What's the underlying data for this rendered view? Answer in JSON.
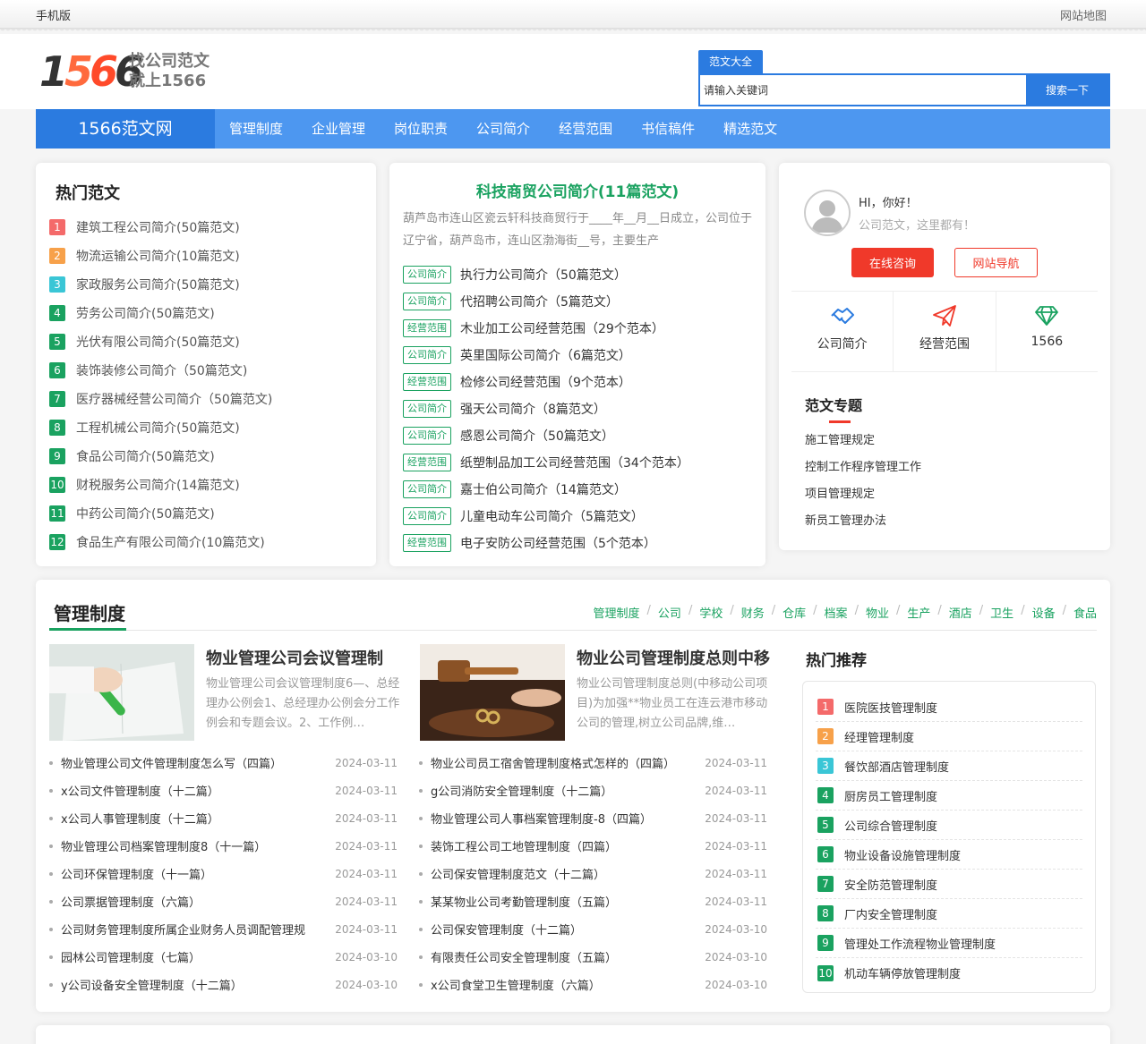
{
  "colors": {
    "primary": "#2b7be0",
    "nav": "#4d97f0",
    "green": "#1aa260",
    "red": "#f0392a",
    "rank": [
      "#f46a6a",
      "#f7a14a",
      "#3ac6d6",
      "#1aa260"
    ]
  },
  "topbar": {
    "mobile": "手机版",
    "sitemap": "网站地图"
  },
  "logo": {
    "digits": [
      "1",
      "5",
      "6",
      "6"
    ],
    "slogan_line1": "找公司范文",
    "slogan_line2": "就上1566"
  },
  "search": {
    "tab": "范文大全",
    "placeholder": "请输入关键词",
    "button": "搜索一下"
  },
  "nav": {
    "brand": "1566范文网",
    "items": [
      "管理制度",
      "企业管理",
      "岗位职责",
      "公司简介",
      "经营范围",
      "书信稿件",
      "精选范文"
    ]
  },
  "hot": {
    "title": "热门范文",
    "items": [
      "建筑工程公司简介(50篇范文)",
      "物流运输公司简介(10篇范文)",
      "家政服务公司简介(50篇范文)",
      "劳务公司简介(50篇范文)",
      "光伏有限公司简介(50篇范文)",
      "装饰装修公司简介（50篇范文)",
      "医疗器械经营公司简介（50篇范文)",
      "工程机械公司简介(50篇范文)",
      "食品公司简介(50篇范文)",
      "财税服务公司简介(14篇范文)",
      "中药公司简介(50篇范文)",
      "食品生产有限公司简介(10篇范文)"
    ]
  },
  "feature": {
    "title": "科技商贸公司简介(11篇范文)",
    "desc": "葫芦岛市连山区瓷云轩科技商贸行于____年__月__日成立，公司位于辽宁省，葫芦岛市，连山区渤海街__号，主要生产",
    "items": [
      {
        "tag": "公司简介",
        "text": "执行力公司简介（50篇范文）"
      },
      {
        "tag": "公司简介",
        "text": "代招聘公司简介（5篇范文）"
      },
      {
        "tag": "经营范围",
        "text": "木业加工公司经营范围（29个范本）"
      },
      {
        "tag": "公司简介",
        "text": "英里国际公司简介（6篇范文）"
      },
      {
        "tag": "经营范围",
        "text": "检修公司经营范围（9个范本）"
      },
      {
        "tag": "公司简介",
        "text": "强天公司简介（8篇范文）"
      },
      {
        "tag": "公司简介",
        "text": "感恩公司简介（50篇范文）"
      },
      {
        "tag": "经营范围",
        "text": "纸塑制品加工公司经营范围（34个范本）"
      },
      {
        "tag": "公司简介",
        "text": "嘉士伯公司简介（14篇范文）"
      },
      {
        "tag": "公司简介",
        "text": "儿童电动车公司简介（5篇范文）"
      },
      {
        "tag": "经营范围",
        "text": "电子安防公司经营范围（5个范本）"
      }
    ]
  },
  "user": {
    "greeting": "HI，你好！",
    "subtitle": "公司范文，这里都有！",
    "btn_consult": "在线咨询",
    "btn_nav": "网站导航",
    "grid": [
      {
        "icon": "handshake-icon",
        "label": "公司简介"
      },
      {
        "icon": "paper-plane-icon",
        "label": "经营范围"
      },
      {
        "icon": "diamond-icon",
        "label": "1566"
      }
    ],
    "topics_title": "范文专题",
    "topics": [
      "施工管理规定",
      "控制工作程序管理工作",
      "项目管理规定",
      "新员工管理办法"
    ]
  },
  "mgmt": {
    "title": "管理制度",
    "cats": [
      "管理制度",
      "公司",
      "学校",
      "财务",
      "仓库",
      "档案",
      "物业",
      "生产",
      "酒店",
      "卫生",
      "设备",
      "食品"
    ],
    "feature_left": {
      "title": "物业管理公司会议管理制",
      "desc": "物业管理公司会议管理制度6—、总经理办公例会1、总经理办公例会分工作例会和专题会议。2、工作例…"
    },
    "feature_right": {
      "title": "物业公司管理制度总则中移",
      "desc": "物业公司管理制度总则(中移动公司项目)为加强**物业员工在连云港市移动公司的管理,树立公司品牌,维…"
    },
    "left_rows": [
      {
        "t": "物业管理公司文件管理制度怎么写（四篇）",
        "d": "2024-03-11"
      },
      {
        "t": "x公司文件管理制度（十二篇）",
        "d": "2024-03-11"
      },
      {
        "t": "x公司人事管理制度（十二篇）",
        "d": "2024-03-11"
      },
      {
        "t": "物业管理公司档案管理制度8（十一篇）",
        "d": "2024-03-11"
      },
      {
        "t": "公司环保管理制度（十一篇）",
        "d": "2024-03-11"
      },
      {
        "t": "公司票据管理制度（六篇）",
        "d": "2024-03-11"
      },
      {
        "t": "公司财务管理制度所属企业财务人员调配管理规",
        "d": "2024-03-11"
      },
      {
        "t": "园林公司管理制度（七篇）",
        "d": "2024-03-10"
      },
      {
        "t": "y公司设备安全管理制度（十二篇）",
        "d": "2024-03-10"
      }
    ],
    "right_rows": [
      {
        "t": "物业公司员工宿舍管理制度格式怎样的（四篇）",
        "d": "2024-03-11"
      },
      {
        "t": "g公司消防安全管理制度（十二篇）",
        "d": "2024-03-11"
      },
      {
        "t": "物业管理公司人事档案管理制度-8（四篇）",
        "d": "2024-03-11"
      },
      {
        "t": "装饰工程公司工地管理制度（四篇）",
        "d": "2024-03-11"
      },
      {
        "t": "公司保安管理制度范文（十二篇）",
        "d": "2024-03-11"
      },
      {
        "t": "某某物业公司考勤管理制度（五篇）",
        "d": "2024-03-11"
      },
      {
        "t": "公司保安管理制度（十二篇）",
        "d": "2024-03-10"
      },
      {
        "t": "有限责任公司安全管理制度（五篇）",
        "d": "2024-03-10"
      },
      {
        "t": "x公司食堂卫生管理制度（六篇）",
        "d": "2024-03-10"
      }
    ],
    "rec_title": "热门推荐",
    "rec": [
      "医院医技管理制度",
      "经理管理制度",
      "餐饮部酒店管理制度",
      "厨房员工管理制度",
      "公司综合管理制度",
      "物业设备设施管理制度",
      "安全防范管理制度",
      "厂内安全管理制度",
      "管理处工作流程物业管理制度",
      "机动车辆停放管理制度"
    ]
  }
}
